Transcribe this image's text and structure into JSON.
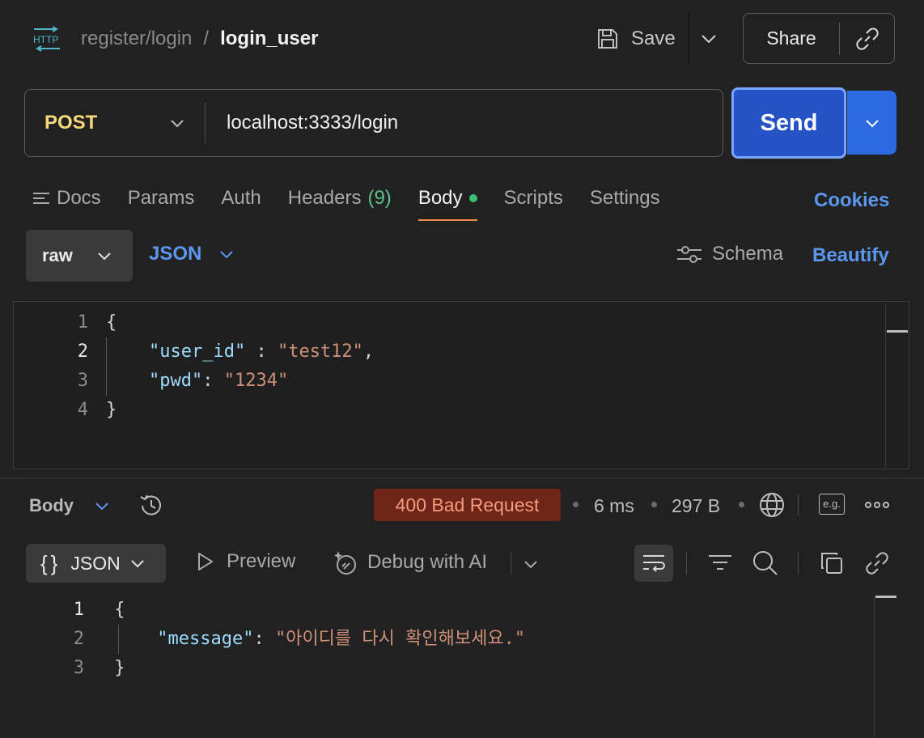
{
  "header": {
    "icon_text": "HTTP",
    "breadcrumb_parent": "register/login",
    "breadcrumb_separator": "/",
    "breadcrumb_current": "login_user",
    "save_label": "Save",
    "share_label": "Share"
  },
  "request": {
    "method": "POST",
    "url": "localhost:3333/login",
    "send_label": "Send"
  },
  "tabs": {
    "docs": "Docs",
    "params": "Params",
    "auth": "Auth",
    "headers": "Headers",
    "headers_count": "(9)",
    "body": "Body",
    "scripts": "Scripts",
    "settings": "Settings",
    "cookies": "Cookies"
  },
  "body_toolbar": {
    "mode": "raw",
    "language": "JSON",
    "schema": "Schema",
    "beautify": "Beautify"
  },
  "request_body": {
    "line_numbers": [
      "1",
      "2",
      "3",
      "4"
    ],
    "open_brace": "{",
    "key1": "\"user_id\"",
    "colon1": " : ",
    "val1": "\"test12\"",
    "comma1": ",",
    "key2": "\"pwd\"",
    "colon2": ": ",
    "val2": "\"1234\"",
    "close_brace": "}"
  },
  "response": {
    "section_label": "Body",
    "status": "400 Bad Request",
    "time": "6 ms",
    "size": "297 B",
    "example_label": "e.g.",
    "format": "JSON",
    "preview": "Preview",
    "debug_ai": "Debug with AI"
  },
  "response_body": {
    "line_numbers": [
      "1",
      "2",
      "3"
    ],
    "open_brace": "{",
    "key1": "\"message\"",
    "colon1": ": ",
    "val1": "\"아이디를 다시 확인해보세요.\"",
    "close_brace": "}"
  },
  "colors": {
    "method": "#f5d97a",
    "send": "#2553c5",
    "accent_link": "#5b96ef",
    "status_bg": "#6e2416",
    "status_text": "#f39b80",
    "json_key": "#9cdcfe",
    "json_string": "#ce9178"
  }
}
